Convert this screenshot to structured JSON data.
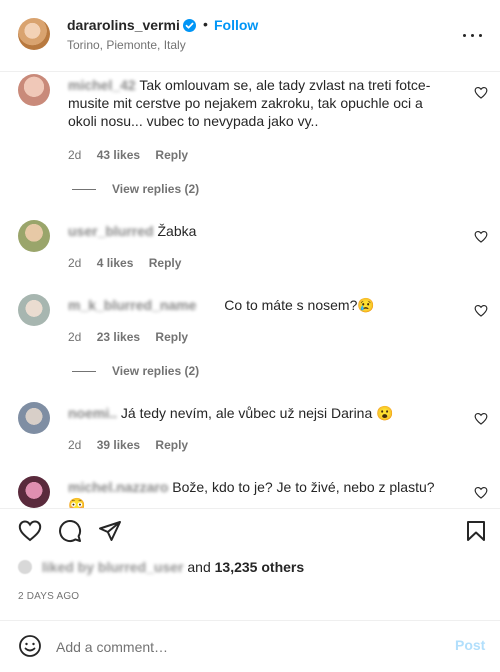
{
  "header": {
    "username": "dararolins_vermi",
    "dot": "•",
    "follow_label": "Follow",
    "location": "Torino, Piemonte, Italy"
  },
  "comments": [
    {
      "user": "michel_42",
      "text": "Tak omlouvam se, ale tady zvlast na treti fotce-musite mit cerstve po nejakem zakroku, tak opuchle oci a okoli nosu... vubec to nevypada jako vy..",
      "time": "2d",
      "likes": "43 likes",
      "reply": "Reply",
      "view_replies": "View replies (2)"
    },
    {
      "user": "user_blurred",
      "text": "Žabka",
      "time": "2d",
      "likes": "4 likes",
      "reply": "Reply"
    },
    {
      "user": "m_k_blurred_name",
      "text": "Co to máte s nosem?😢",
      "time": "2d",
      "likes": "23 likes",
      "reply": "Reply",
      "view_replies": "View replies (2)"
    },
    {
      "user": "noemi..",
      "text": "Já tedy nevím, ale vůbec už nejsi Darina 😮",
      "time": "2d",
      "likes": "39 likes",
      "reply": "Reply"
    },
    {
      "user": "michel.nazzaro",
      "text": "Bože, kdo to je? Je to živé, nebo z plastu? 😳",
      "time": "",
      "likes": "",
      "reply": ""
    }
  ],
  "likes_line": {
    "users": "liked by blurred_user",
    "and": "and",
    "others": "13,235 others"
  },
  "time_ago": "2 DAYS AGO",
  "add_comment": {
    "placeholder": "Add a comment…",
    "post_label": "Post"
  },
  "colors": {
    "accent": "#0095f6",
    "post_disabled": "#b2dffc",
    "secondary_text": "#737373"
  },
  "icons": [
    "verified-icon",
    "more-options-icon",
    "heart-icon",
    "comment-icon",
    "share-icon",
    "bookmark-icon",
    "emoji-icon"
  ]
}
